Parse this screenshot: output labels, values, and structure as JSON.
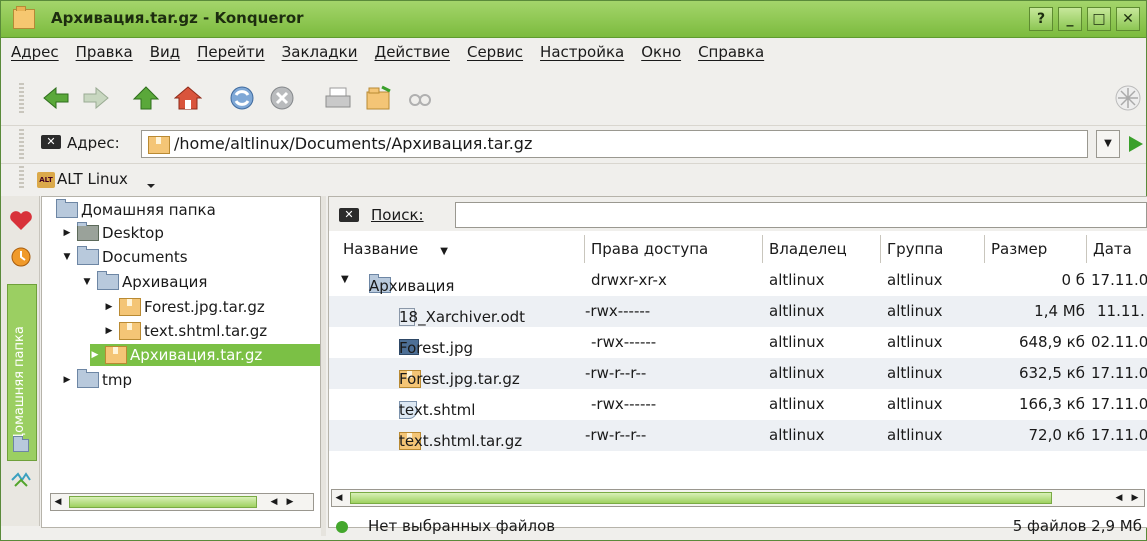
{
  "window": {
    "title": "Архивация.tar.gz - Konqueror",
    "buttons": [
      "?",
      "_",
      "□",
      "✕"
    ]
  },
  "menu": [
    "Адрес",
    "Правка",
    "Вид",
    "Перейти",
    "Закладки",
    "Действие",
    "Сервис",
    "Настройка",
    "Окно",
    "Справка"
  ],
  "toolbar": {
    "icons": [
      "back-icon",
      "forward-icon",
      "up-icon",
      "home-icon",
      "reload-icon",
      "stop-icon",
      "print-icon",
      "archive-icon",
      "binoculars-icon"
    ]
  },
  "location": {
    "label": "Адрес:",
    "value": "/home/altlinux/Documents/Архивация.tar.gz"
  },
  "bookmarks": {
    "item": "ALT Linux"
  },
  "sidepanel": {
    "tab_label": "Домашняя папка"
  },
  "tree": [
    "Домашняя папка",
    "Desktop",
    "Documents",
    "Архивация",
    "Forest.jpg.tar.gz",
    "text.shtml.tar.gz",
    "Архивация.tar.gz",
    "tmp"
  ],
  "search": {
    "label": "Поиск:"
  },
  "columns": [
    "Название",
    "Права доступа",
    "Владелец",
    "Группа",
    "Размер",
    "Дата"
  ],
  "rows": [
    {
      "name": "Архивация",
      "perm": "drwxr-xr-x",
      "owner": "altlinux",
      "group": "altlinux",
      "size": "0 б",
      "date": "17.11.0"
    },
    {
      "name": "18_Xarchiver.odt",
      "perm": "-rwx------",
      "owner": "altlinux",
      "group": "altlinux",
      "size": "1,4 Мб",
      "date": "11.11."
    },
    {
      "name": "Forest.jpg",
      "perm": "-rwx------",
      "owner": "altlinux",
      "group": "altlinux",
      "size": "648,9 кб",
      "date": "02.11.0"
    },
    {
      "name": "Forest.jpg.tar.gz",
      "perm": "-rw-r--r--",
      "owner": "altlinux",
      "group": "altlinux",
      "size": "632,5 кб",
      "date": "17.11.0"
    },
    {
      "name": "text.shtml",
      "perm": "-rwx------",
      "owner": "altlinux",
      "group": "altlinux",
      "size": "166,3 кб",
      "date": "17.11.0"
    },
    {
      "name": "text.shtml.tar.gz",
      "perm": "-rw-r--r--",
      "owner": "altlinux",
      "group": "altlinux",
      "size": "72,0 кб",
      "date": "17.11.0"
    }
  ],
  "status": {
    "left": "Нет выбранных файлов",
    "right": "5 файлов 2,9 Мб"
  },
  "colors": {
    "accent": "#7bc045",
    "titlebar": "#8cc653"
  }
}
